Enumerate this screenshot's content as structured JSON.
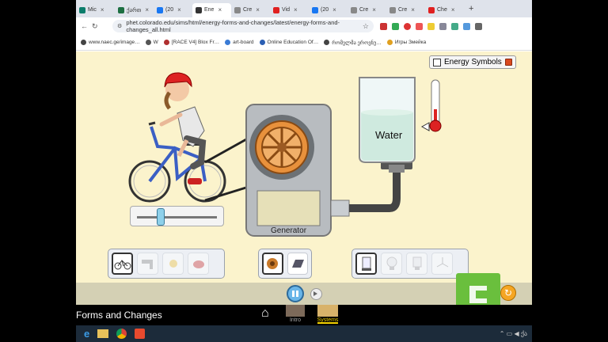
{
  "browser": {
    "tabs": [
      {
        "label": "Mic",
        "color": "#0c7d6b",
        "active": false
      },
      {
        "label": "ქართ",
        "color": "#1d6f42",
        "active": false
      },
      {
        "label": "(20",
        "color": "#1877f2",
        "active": false
      },
      {
        "label": "Ene",
        "color": "#333333",
        "active": true
      },
      {
        "label": "Cre",
        "color": "#888888",
        "active": false
      },
      {
        "label": "Vid",
        "color": "#e02020",
        "active": false
      },
      {
        "label": "(20",
        "color": "#1877f2",
        "active": false
      },
      {
        "label": "Cre",
        "color": "#888888",
        "active": false
      },
      {
        "label": "Cre",
        "color": "#888888",
        "active": false
      },
      {
        "label": "Che",
        "color": "#e02020",
        "active": false
      }
    ],
    "url": "phet.colorado.edu/sims/html/energy-forms-and-changes/latest/energy-forms-and-changes_all.html",
    "bookmarks": [
      {
        "label": "www.naec.ge/image…",
        "color": "#444"
      },
      {
        "label": "W",
        "color": "#555"
      },
      {
        "label": "[RACE V4] Blox Fr…",
        "color": "#b03030"
      },
      {
        "label": "art-board",
        "color": "#3a7bd5"
      },
      {
        "label": "Online Education Of…",
        "color": "#2b5fb3"
      },
      {
        "label": "რომელმა ეროვნუ…",
        "color": "#444"
      },
      {
        "label": "Игры Змейка",
        "color": "#e0a020"
      }
    ]
  },
  "sim": {
    "energy_symbols_label": "Energy Symbols",
    "energy_symbols_checked": false,
    "water_label": "Water",
    "generator_label": "Generator",
    "slider_value": 0.3,
    "source_panel": [
      "bicycle",
      "faucet",
      "sun",
      "teapot"
    ],
    "converter_panel": [
      "generator-wheel",
      "solar-panel"
    ],
    "user_panel": [
      "beaker-heater",
      "incandescent-bulb",
      "fluorescent-bulb",
      "fan"
    ],
    "colors": {
      "background": "#fbf3cc",
      "control_bar": "#d4d0b4",
      "accent": "#f5a623"
    }
  },
  "navbar": {
    "title": "Forms and Changes",
    "screens": [
      {
        "label": "Intro"
      },
      {
        "label": "Systems"
      }
    ]
  }
}
